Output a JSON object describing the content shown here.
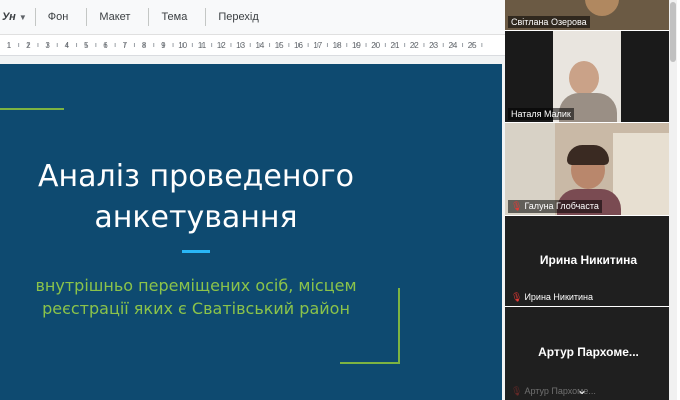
{
  "toolbar": {
    "format_fragment": "Ун",
    "items": [
      {
        "label": "Фон"
      },
      {
        "label": "Макет"
      },
      {
        "label": "Тема"
      },
      {
        "label": "Перехід"
      }
    ]
  },
  "ruler": {
    "ticks": [
      "1",
      "2",
      "3",
      "4",
      "5",
      "6",
      "7",
      "8",
      "9",
      "10",
      "11",
      "12",
      "13",
      "14",
      "15",
      "16",
      "17",
      "18",
      "19",
      "20",
      "21",
      "22",
      "23",
      "24",
      "25"
    ]
  },
  "slide": {
    "title_line1": "Аналіз проведеного",
    "title_line2": "анкетування",
    "subtitle_line1": "внутрішньо переміщених осіб, місцем",
    "subtitle_line2": "реєстрації яких є Сватівський район"
  },
  "participants": [
    {
      "name": "Світлана Озерова",
      "video": true
    },
    {
      "name": "Наталя  Малик",
      "video": true
    },
    {
      "name": "Галуна Глобчаста",
      "video": true,
      "muted": true
    },
    {
      "name": "Ирина Никитина",
      "display_name": "Ирина Никитина",
      "video": false,
      "muted": true
    },
    {
      "name": "Артур Пархоме...",
      "display_name": "Артур  Пархоме...",
      "video": false,
      "muted": true
    }
  ],
  "colors": {
    "slide_bg": "#0e4a70",
    "title": "#ffffff",
    "subtitle": "#8bc34a",
    "accent_green": "#7cb342",
    "accent_blue": "#29b6f6"
  }
}
